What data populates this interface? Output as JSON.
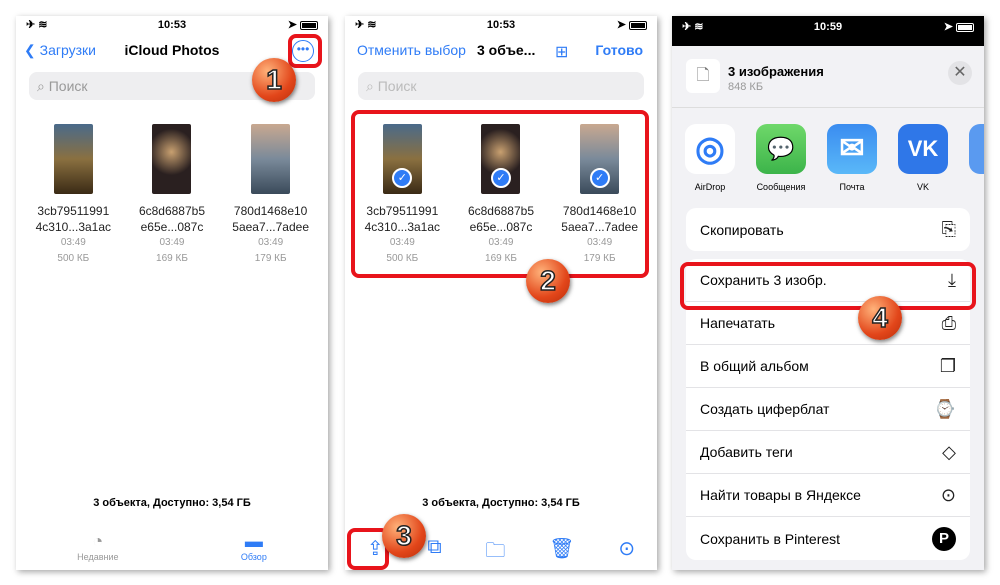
{
  "colors": {
    "accent": "#2f7cf6",
    "highlight": "#e8141b",
    "badge": "#e2461a"
  },
  "panel1": {
    "time": "10:53",
    "back_label": "Загрузки",
    "title": "iCloud Photos",
    "search_placeholder": "Поиск",
    "files": [
      {
        "name1": "3cb79511991",
        "name2": "4c310...3a1ac",
        "time": "03:49",
        "size": "500 КБ"
      },
      {
        "name1": "6c8d6887b5",
        "name2": "e65e...087c",
        "time": "03:49",
        "size": "169 КБ"
      },
      {
        "name1": "780d1468e10",
        "name2": "5aea7...7adee",
        "time": "03:49",
        "size": "179 КБ"
      }
    ],
    "footer": "3 объекта, Доступно: 3,54 ГБ",
    "tabs": [
      {
        "label": "Недавние",
        "icon": "clock-icon"
      },
      {
        "label": "Обзор",
        "icon": "folder-icon"
      }
    ],
    "badge": "1"
  },
  "panel2": {
    "time": "10:53",
    "cancel_label": "Отменить выбор",
    "title": "3 объе...",
    "done_label": "Готово",
    "search_placeholder": "Поиск",
    "footer": "3 объекта, Доступно: 3,54 ГБ",
    "badge2": "2",
    "badge3": "3",
    "toolbar": [
      "share-icon",
      "duplicate-icon",
      "folder-icon",
      "trash-icon",
      "more-icon"
    ]
  },
  "panel3": {
    "time": "10:59",
    "title": "3 изображения",
    "size": "848 КБ",
    "apps": [
      {
        "label": "AirDrop",
        "glyph": "◎"
      },
      {
        "label": "Сообщения",
        "glyph": "💬"
      },
      {
        "label": "Почта",
        "glyph": "✉"
      },
      {
        "label": "VK",
        "glyph": "VK"
      }
    ],
    "actions_top": [
      {
        "label": "Скопировать",
        "icon": "copy-icon",
        "glyph": "⎘"
      }
    ],
    "actions": [
      {
        "label": "Сохранить 3 изобр.",
        "icon": "download-icon",
        "glyph": "⤓"
      },
      {
        "label": "Напечатать",
        "icon": "printer-icon",
        "glyph": "⎙"
      },
      {
        "label": "В общий альбом",
        "icon": "shared-album-icon",
        "glyph": "❐"
      },
      {
        "label": "Создать циферблат",
        "icon": "watch-icon",
        "glyph": "⌚"
      },
      {
        "label": "Добавить теги",
        "icon": "tag-icon",
        "glyph": "◇"
      },
      {
        "label": "Найти товары в Яндексе",
        "icon": "scan-icon",
        "glyph": "⊙"
      },
      {
        "label": "Сохранить в Pinterest",
        "icon": "pinterest-icon",
        "glyph": "P"
      }
    ],
    "badge": "4"
  }
}
